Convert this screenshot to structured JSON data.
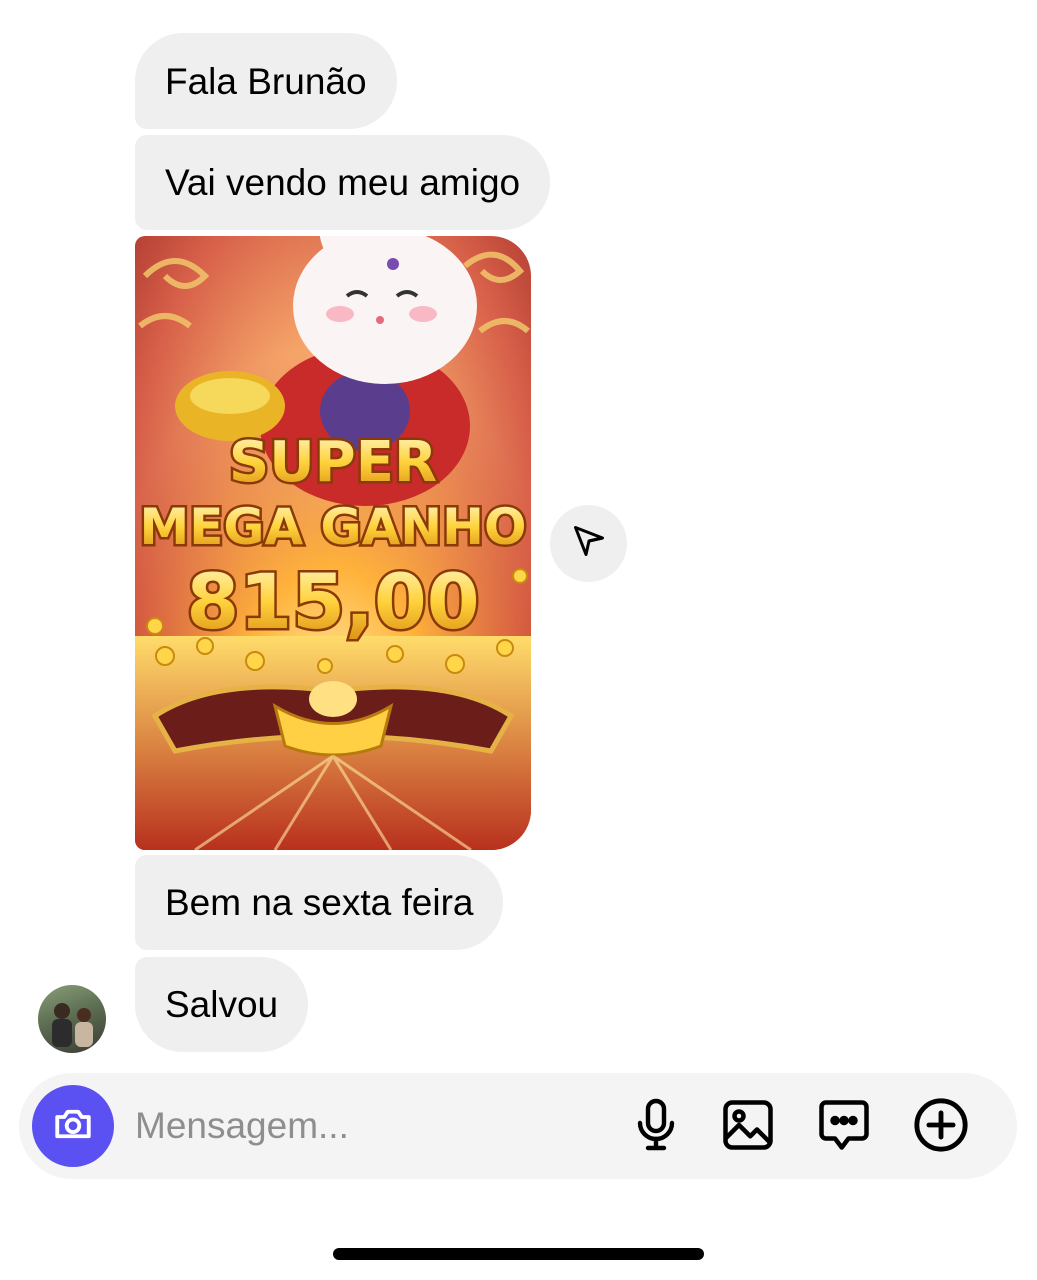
{
  "messages": [
    {
      "text": "Fala Brunão"
    },
    {
      "text": "Vai vendo meu amigo"
    },
    {
      "text": "Bem na sexta feira"
    },
    {
      "text": "Salvou"
    }
  ],
  "media": {
    "line1": "SUPER",
    "line2": "MEGA GANHO",
    "amount": "815,00"
  },
  "icons": {
    "share": "paper-plane-icon",
    "camera": "camera-icon",
    "mic": "microphone-icon",
    "gallery": "image-icon",
    "sticker": "chat-bubble-icon",
    "plus": "add-circle-icon"
  },
  "composer": {
    "placeholder": "Mensagem..."
  },
  "colors": {
    "bubble": "#efefef",
    "camera_button": "#5b51f2",
    "placeholder": "#8e8e8e"
  }
}
